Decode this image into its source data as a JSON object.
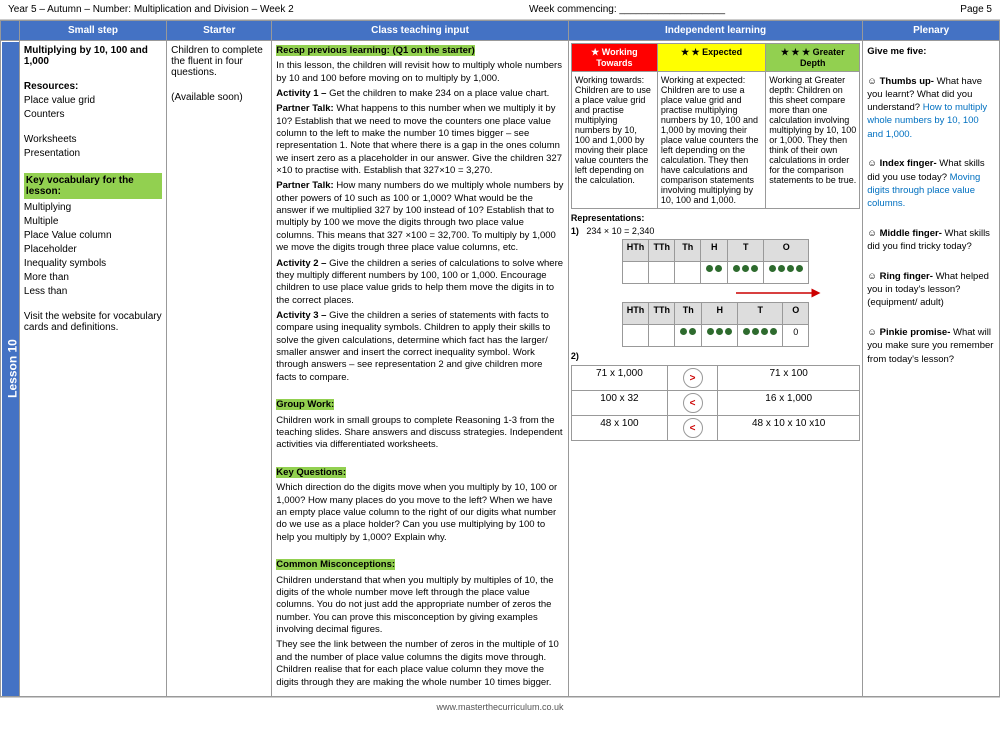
{
  "header": {
    "title": "Year 5 – Autumn – Number: Multiplication and Division  – Week 2",
    "week_commencing_label": "Week commencing: ___________________",
    "page": "Page 5"
  },
  "columns": {
    "small_step": "Small step",
    "starter": "Starter",
    "teaching": "Class teaching input",
    "independent": "Independent learning",
    "plenary": "Plenary"
  },
  "lesson_label": "Lesson 10",
  "small_step": {
    "title": "Multiplying by 10, 100 and 1,000",
    "resources_label": "Resources:",
    "resources": [
      "Place value grid",
      "Counters",
      "",
      "Worksheets",
      "Presentation"
    ],
    "key_vocab_label": "Key vocabulary for the lesson:",
    "vocab_list": [
      "Multiplying",
      "Multiple",
      "Place Value column",
      "Placeholder",
      "Inequality symbols",
      "More than",
      "Less than"
    ],
    "visit_text": "Visit the website for vocabulary cards and definitions."
  },
  "starter": {
    "text": "Children to complete the fluent in four questions.",
    "available_soon": "(Available soon)"
  },
  "teaching": {
    "recap_label": "Recap previous learning: (Q1 on the starter)",
    "recap_text": "In this lesson, the children will revisit how to multiply whole numbers by 10 and 100 before moving on to multiply by 1,000.",
    "activity1_label": "Activity 1 –",
    "activity1_text": "Get the children to make 234 on a place value chart.",
    "partner_talk1_label": "Partner Talk:",
    "partner_talk1_text": "What happens to this number when we multiply it by 10? Establish that we need to move the counters one place value column to the left to make the number 10 times bigger – see representation 1. Note that where there is a gap in the ones column we insert zero as a placeholder in our answer. Give the children 327 ×10 to practise with. Establish that 327×10 = 3,270.",
    "partner_talk2_label": "Partner Talk:",
    "partner_talk2_text": "How many numbers do we multiply whole numbers by other powers of 10 such as 100 or 1,000? What would be the answer if we multiplied 327 by 100 instead of 10? Establish that to multiply by 100 we move the digits through two place value columns. This means that 327 ×100 = 32,700. To multiply by 1,000 we move the digits trough three place value columns, etc.",
    "activity2_label": "Activity 2 –",
    "activity2_text": "Give the children a series of calculations to solve where they multiply different numbers by 100, 100 or 1,000. Encourage children to use place value grids to help them move the digits in to the correct places.",
    "activity3_label": "Activity 3 –",
    "activity3_text": "Give the children a series of statements with facts to compare using inequality symbols. Children to apply their skills to solve the given calculations, determine which fact has the larger/ smaller answer and insert the correct inequality symbol. Work through answers – see representation 2 and give children more facts to compare.",
    "group_work_label": "Group Work:",
    "group_work_text": "Children work in small groups to complete Reasoning 1-3 from the teaching slides. Share answers and discuss strategies. Independent activities via differentiated worksheets.",
    "key_questions_label": "Key Questions:",
    "key_questions_text": "Which direction do the digits move when you multiply by 10, 100 or 1,000? How many places do you move to the left? When we have an empty place value column to the right of our digits what number do we use as a place holder? Can you use multiplying by 100 to help you multiply by 1,000? Explain why.",
    "misconceptions_label": "Common Misconceptions:",
    "misconceptions_text": "Children understand that when you multiply by multiples of 10, the digits of the whole number move left through the place value columns. You do not just add the appropriate number of zeros the number. You can prove this misconception by giving examples involving decimal figures.",
    "misconceptions_text2": "They see the link between the number of zeros in the multiple of 10 and the number of place value columns the digits move through. Children realise that for each place value column they move the digits through they are making the whole number 10 times bigger."
  },
  "independent": {
    "working_towards_header": "Working Towards",
    "expected_header": "Expected",
    "greater_depth_header": "Greater Depth",
    "working_towards_star": "★",
    "expected_stars": "★ ★",
    "greater_depth_stars": "★ ★ ★",
    "working_towards_text": "Working towards: Children are to use a place value grid and practise multiplying numbers by 10, 100 and 1,000 by moving their place value counters the left depending on the calculation.",
    "expected_text": "Working at expected: Children are to use a place value grid and practise multiplying numbers by 10, 100 and 1,000 by moving their place value counters the left depending on the calculation. They then have calculations and comparison statements involving multiplying by 10, 100 and 1,000.",
    "greater_depth_text": "Working at Greater depth: Children on this sheet compare more than one calculation involving multiplying by 10, 100 or 1,000. They then think of their own calculations in order for the comparison statements to be true.",
    "representations_label": "Representations:",
    "rep1_label": "1)",
    "rep1_calc": "234 × 10 = 2,340",
    "place_value_headers_top": [
      "HTh",
      "TTh",
      "Th",
      "H",
      "T",
      "O"
    ],
    "place_value_headers_bottom": [
      "HTh",
      "TTh",
      "Th",
      "H",
      "T",
      "O"
    ],
    "rep2_label": "2)",
    "comparisons": [
      {
        "left": "71 x 1,000",
        "symbol": ">",
        "right": "71 x 100"
      },
      {
        "left": "100 x 32",
        "symbol": "<",
        "right": "16 x 1,000"
      },
      {
        "left": "48 x 100",
        "symbol": "<",
        "right": "48 x 10 x 10 x10"
      }
    ]
  },
  "plenary": {
    "give_me_five": "Give me five:",
    "thumb_label": "Thumbs up-",
    "thumb_text": "What have you learnt? What did you understand?",
    "thumb_link": "How to multiply whole numbers by 10, 100 and 1,000.",
    "index_label": "Index finger-",
    "index_text": "What skills did you use today?",
    "index_link": "Moving digits through place value columns.",
    "middle_label": "Middle finger-",
    "middle_text": "What skills did you find tricky today?",
    "ring_label": "Ring finger-",
    "ring_text": "What helped you in today's lesson? (equipment/ adult)",
    "pinkie_label": "Pinkie promise-",
    "pinkie_text": "What will you make sure you remember from today's lesson?"
  },
  "footer": {
    "url": "www.masterthecurriculum.co.uk"
  }
}
